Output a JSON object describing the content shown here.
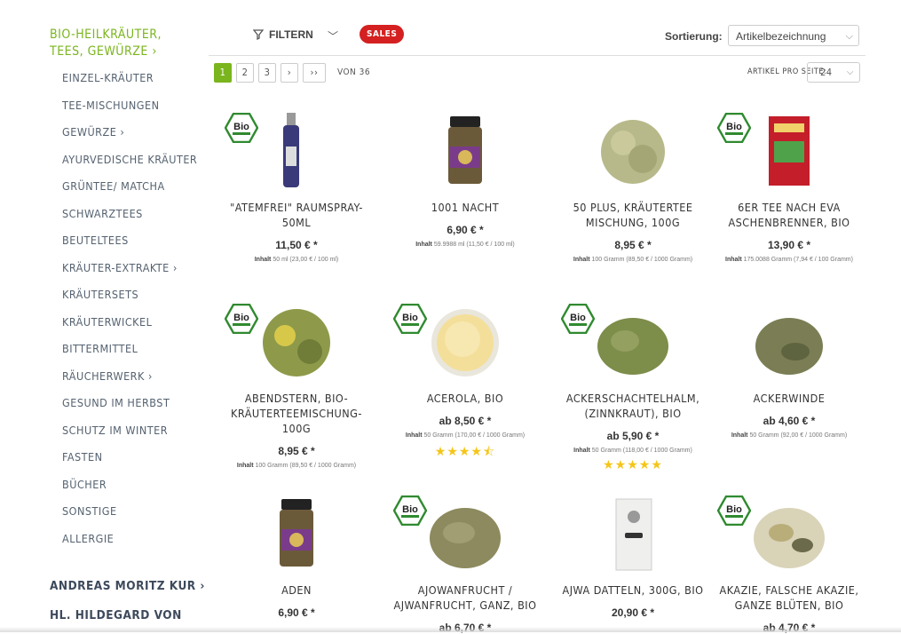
{
  "sidebar": {
    "main_category": "Bio-Heilkräuter, Tees, Gewürze ›",
    "items": [
      "Einzel-Kräuter",
      "Tee-Mischungen",
      "Gewürze ›",
      "Ayurvedische Kräuter",
      "Grüntee/ Matcha",
      "Schwarztees",
      "Beuteltees",
      "Kräuter-Extrakte ›",
      "Kräutersets",
      "Kräuterwickel",
      "Bittermittel",
      "Räucherwerk ›",
      "Gesund im Herbst",
      "Schutz im Winter",
      "Fasten",
      "Bücher",
      "Sonstige",
      "Allergie"
    ],
    "more_categories": [
      "Andreas Moritz Kur ›",
      "Hl. Hildegard von"
    ]
  },
  "toolbar": {
    "filter_label": "FILTERN",
    "sales_label": "SALES",
    "sort_label": "Sortierung:",
    "sort_value": "Artikelbezeichnung"
  },
  "pagination": {
    "pages": [
      "1",
      "2",
      "3",
      "›",
      "››"
    ],
    "total": "von 36",
    "per_page_label": "Artikel pro Seite:",
    "per_page_value": "24"
  },
  "products": [
    {
      "title": "\"Atemfrei\" Raumspray-50ml",
      "price": "11,50 € *",
      "inhalt_label": "Inhalt",
      "inhalt": "50 ml (23,00 € / 100 ml)",
      "bio": true,
      "image": "spray-bottle"
    },
    {
      "title": "1001 Nacht",
      "price": "6,90 € *",
      "inhalt_label": "Inhalt",
      "inhalt": "59.9988 ml (11,50 € / 100 ml)",
      "bio": false,
      "image": "jar"
    },
    {
      "title": "50 plus, Kräutertee Mischung, 100g",
      "price": "8,95 € *",
      "inhalt_label": "Inhalt",
      "inhalt": "100 Gramm (89,50 € / 1000 Gramm)",
      "bio": false,
      "image": "herbs-light"
    },
    {
      "title": "6er Tee nach Eva Aschenbrenner, Bio",
      "price": "13,90 € *",
      "inhalt_label": "Inhalt",
      "inhalt": "175.0088 Gramm (7,94 € / 100 Gramm)",
      "bio": true,
      "image": "red-bag"
    },
    {
      "title": "Abendstern, Bio-Kräuterteemischung-100g",
      "price": "8,95 € *",
      "inhalt_label": "Inhalt",
      "inhalt": "100 Gramm (89,50 € / 1000 Gramm)",
      "bio": true,
      "image": "herbs-mix"
    },
    {
      "title": "Acerola, Bio",
      "price": "ab 8,50 € *",
      "inhalt_label": "Inhalt",
      "inhalt": "50 Gramm (170,00 € / 1000 Gramm)",
      "bio": true,
      "image": "powder",
      "rating": 4.5,
      "stars": "★★★★⯪"
    },
    {
      "title": "Ackerschachtelhalm, (Zinnkraut), Bio",
      "price": "ab 5,90 € *",
      "inhalt_label": "Inhalt",
      "inhalt": "50 Gramm (118,00 € / 1000 Gramm)",
      "bio": true,
      "image": "herbs-green",
      "rating": 5,
      "stars": "★★★★★"
    },
    {
      "title": "Ackerwinde",
      "price": "ab 4,60 € *",
      "inhalt_label": "Inhalt",
      "inhalt": "50 Gramm (92,00 € / 1000 Gramm)",
      "bio": false,
      "image": "herbs-dark"
    },
    {
      "title": "Aden",
      "price": "6,90 € *",
      "bio": false,
      "image": "jar"
    },
    {
      "title": "Ajowanfrucht / Ajwanfrucht, ganz, Bio",
      "price": "ab 6,70 € *",
      "bio": true,
      "image": "seeds"
    },
    {
      "title": "Ajwa Datteln, 300g, Bio",
      "price": "20,90 € *",
      "bio": false,
      "image": "box"
    },
    {
      "title": "Akazie, falsche Akazie, ganze Blüten, Bio",
      "price": "ab 4,70 € *",
      "bio": true,
      "image": "blossoms"
    }
  ],
  "colors": {
    "accent": "#7ab51d",
    "sales": "#d42020",
    "text_nav": "#556270",
    "stars": "#f5c518"
  }
}
